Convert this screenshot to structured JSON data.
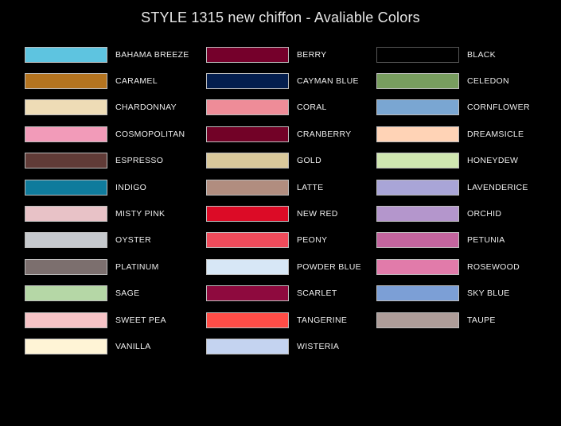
{
  "title": "STYLE 1315 new chiffon - Avaliable Colors",
  "columns": [
    [
      {
        "name": "BAHAMA BREEZE",
        "color": "#5ec4e0"
      },
      {
        "name": "CARAMEL",
        "color": "#b47420"
      },
      {
        "name": "CHARDONNAY",
        "color": "#eedcb6"
      },
      {
        "name": "COSMOPOLITAN",
        "color": "#f29bb9"
      },
      {
        "name": "ESPRESSO",
        "color": "#603b37"
      },
      {
        "name": "INDIGO",
        "color": "#0f7b9c"
      },
      {
        "name": "MISTY PINK",
        "color": "#e8c2c7"
      },
      {
        "name": "OYSTER",
        "color": "#c6c9cd"
      },
      {
        "name": "PLATINUM",
        "color": "#7c6f6e"
      },
      {
        "name": "SAGE",
        "color": "#b5d7a6"
      },
      {
        "name": "SWEET PEA",
        "color": "#f6c3c6"
      },
      {
        "name": "VANILLA",
        "color": "#fff4d6"
      }
    ],
    [
      {
        "name": "BERRY",
        "color": "#75002b"
      },
      {
        "name": "CAYMAN BLUE",
        "color": "#041e4e"
      },
      {
        "name": "CORAL",
        "color": "#ee8c98"
      },
      {
        "name": "CRANBERRY",
        "color": "#720227"
      },
      {
        "name": "GOLD",
        "color": "#d9c89b"
      },
      {
        "name": "LATTE",
        "color": "#b18d7f"
      },
      {
        "name": "NEW RED",
        "color": "#dc0b26"
      },
      {
        "name": "PEONY",
        "color": "#ee4b5b"
      },
      {
        "name": "POWDER BLUE",
        "color": "#d7e7f6"
      },
      {
        "name": "SCARLET",
        "color": "#8e0a3e"
      },
      {
        "name": "TANGERINE",
        "color": "#ff4d47"
      },
      {
        "name": "WISTERIA",
        "color": "#c4d3f0"
      }
    ],
    [
      {
        "name": "BLACK",
        "color": "#000000"
      },
      {
        "name": "CELEDON",
        "color": "#789d5f"
      },
      {
        "name": "CORNFLOWER",
        "color": "#7aa6d2"
      },
      {
        "name": "DREAMSICLE",
        "color": "#ffd3b6"
      },
      {
        "name": "HONEYDEW",
        "color": "#cfe6b0"
      },
      {
        "name": "LAVENDERICE",
        "color": "#a9a5d7"
      },
      {
        "name": "ORCHID",
        "color": "#b496cc"
      },
      {
        "name": "PETUNIA",
        "color": "#c3659e"
      },
      {
        "name": "ROSEWOOD",
        "color": "#e17baa"
      },
      {
        "name": "SKY BLUE",
        "color": "#7c9fd6"
      },
      {
        "name": "TAUPE",
        "color": "#ae9d99"
      }
    ]
  ]
}
